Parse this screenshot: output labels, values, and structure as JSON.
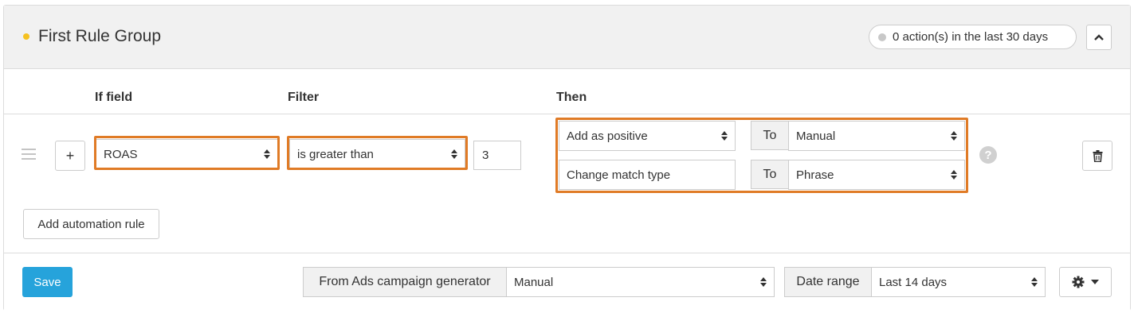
{
  "header": {
    "title": "First Rule Group",
    "title_dot_color": "#f5c120",
    "actions_badge": "0 action(s) in the last 30 days",
    "collapse_icon": "chevron-up-icon"
  },
  "columns": {
    "if_field": "If field",
    "filter": "Filter",
    "then": "Then"
  },
  "rule": {
    "add_button_label": "+",
    "if_field_value": "ROAS",
    "filter_value": "is greater than",
    "threshold_value": "3",
    "then_actions": [
      {
        "action": "Add as positive",
        "to_label": "To",
        "target": "Manual"
      },
      {
        "action": "Change match type",
        "to_label": "To",
        "target": "Phrase"
      }
    ],
    "help_label": "?",
    "delete_icon": "trash-icon"
  },
  "add_rule_button": "Add automation rule",
  "footer": {
    "save_label": "Save",
    "source_label": "From Ads campaign generator",
    "source_value": "Manual",
    "date_range_label": "Date range",
    "date_range_value": "Last 14 days",
    "settings_icon": "gear-icon"
  },
  "colors": {
    "highlight": "#e07b26",
    "primary_button": "#26a3db",
    "header_bg": "#f1f1f1"
  }
}
